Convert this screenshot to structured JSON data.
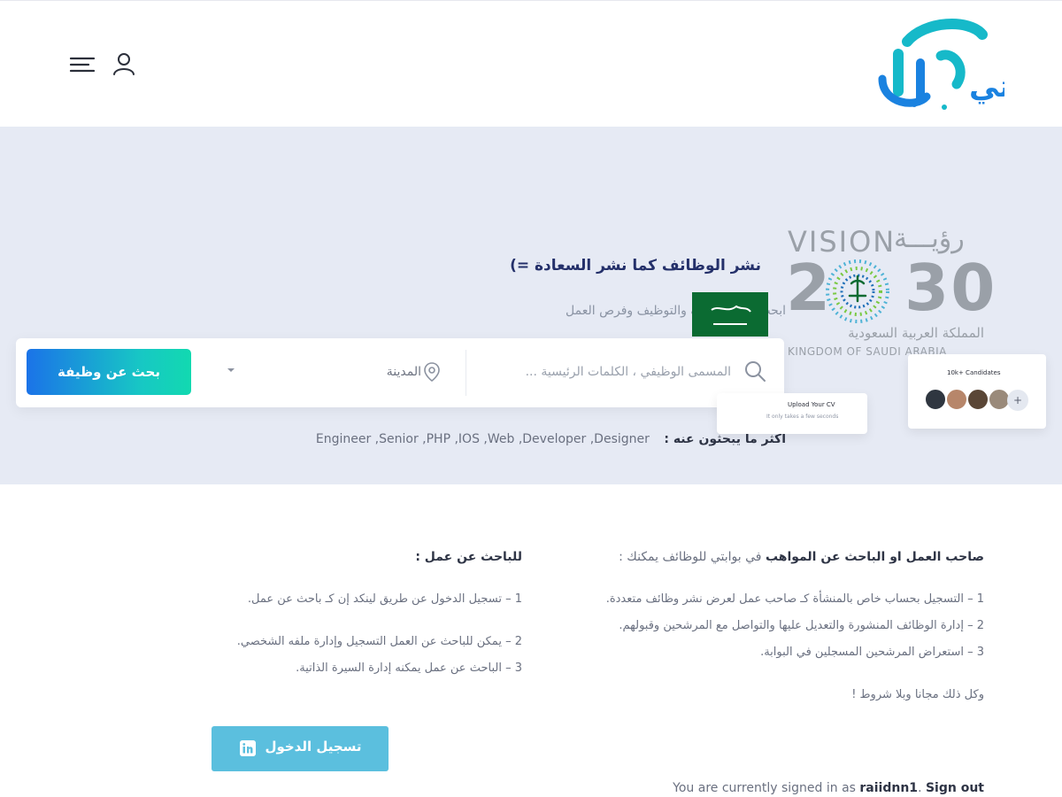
{
  "header": {
    "logo_text": "بوابتي",
    "menu_icon": "hamburger-menu-icon",
    "user_icon": "user-icon"
  },
  "hero": {
    "title": "نشر الوظائف كما نشر السعادة =)",
    "subtitle": "ابحث عن الوظائف والتوظيف وفرص العمل",
    "vision": {
      "word": "VISION",
      "arabic": "رؤيـــة",
      "year": "2030",
      "arabic_kingdom": "المملكة العربية السعودية",
      "english_kingdom": "KINGDOM OF SAUDI ARABIA"
    },
    "search": {
      "keyword_placeholder": "المسمى الوظيفي ، الكلمات الرئيسية ...",
      "city_label": "المدينة",
      "button_label": "بحث عن وظيفة"
    },
    "popular": {
      "label": "أكثر ما يبحثون عنه :",
      "tags": "Engineer ,Senior ,PHP ,IOS ,Web ,Developer ,Designer"
    },
    "cv_card": {
      "title": "Upload Your CV",
      "subtitle": "It only takes a few seconds"
    },
    "candidates_card": {
      "title": "10k+ Candidates",
      "plus": "+"
    }
  },
  "content": {
    "employer": {
      "heading_bold": "صاحب العمل او الباحث عن المواهب",
      "heading_rest": " في بوابتي للوظائف يمكنك :",
      "items": [
        "1 – التسجيل بحساب خاص بالمنشأة كـ صاحب عمل لعرض نشر وظائف متعددة.",
        "2 – إدارة الوظائف المنشورة والتعديل عليها والتواصل مع المرشحين وقبولهم.",
        "3 – استعراض المرشحين المسجلين في البوابة."
      ],
      "footer": "وكل ذلك مجانا وبلا شروط !"
    },
    "seeker": {
      "heading": "للباحث عن عمل :",
      "items": [
        "1 – تسجيل الدخول عن طريق لينكد إن كـ باحث عن عمل.",
        "2 – يمكن للباحث عن العمل التسجيل وإدارة ملفه الشخصي.",
        "3 – الباحث عن عمل يمكنه إدارة السيرة الذاتية."
      ]
    },
    "login_button": "تسجيل الدخول",
    "signed_in": {
      "prefix": "You are currently signed in as ",
      "username": "raiidnn1",
      "separator": ". ",
      "signout": "Sign out"
    }
  },
  "colors": {
    "hero_bg": "#e6eaf4",
    "title_navy": "#24306a",
    "search_gradient_start": "#1b73e8",
    "search_gradient_end": "#12d9b0",
    "login_button": "#5bbfde",
    "vision_gray": "#9aa0a8",
    "flag_green": "#0b6b32"
  }
}
